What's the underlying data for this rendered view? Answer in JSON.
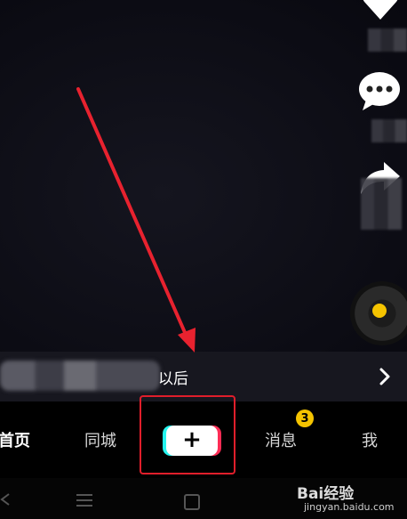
{
  "info_bar": {
    "text": "以后"
  },
  "tabs": [
    {
      "label": "首页",
      "active": true
    },
    {
      "label": "同城",
      "active": false
    },
    {
      "label": "消息",
      "active": false
    },
    {
      "label": "我",
      "active": false
    }
  ],
  "create_button": {
    "label": "+"
  },
  "messages_badge": {
    "count": "3"
  },
  "watermark": {
    "title": "Bai经验",
    "subtitle": "jingyan.baidu.com"
  },
  "icons": {
    "like": "heart-icon",
    "comment": "comment-icon",
    "share": "share-icon",
    "music": "music-disc-icon",
    "chevron": "chevron-right-icon"
  },
  "colors": {
    "accent_cyan": "#25f4ee",
    "accent_red": "#fe2c55",
    "badge": "#f5c400",
    "annotation_red": "#e01e2b"
  }
}
